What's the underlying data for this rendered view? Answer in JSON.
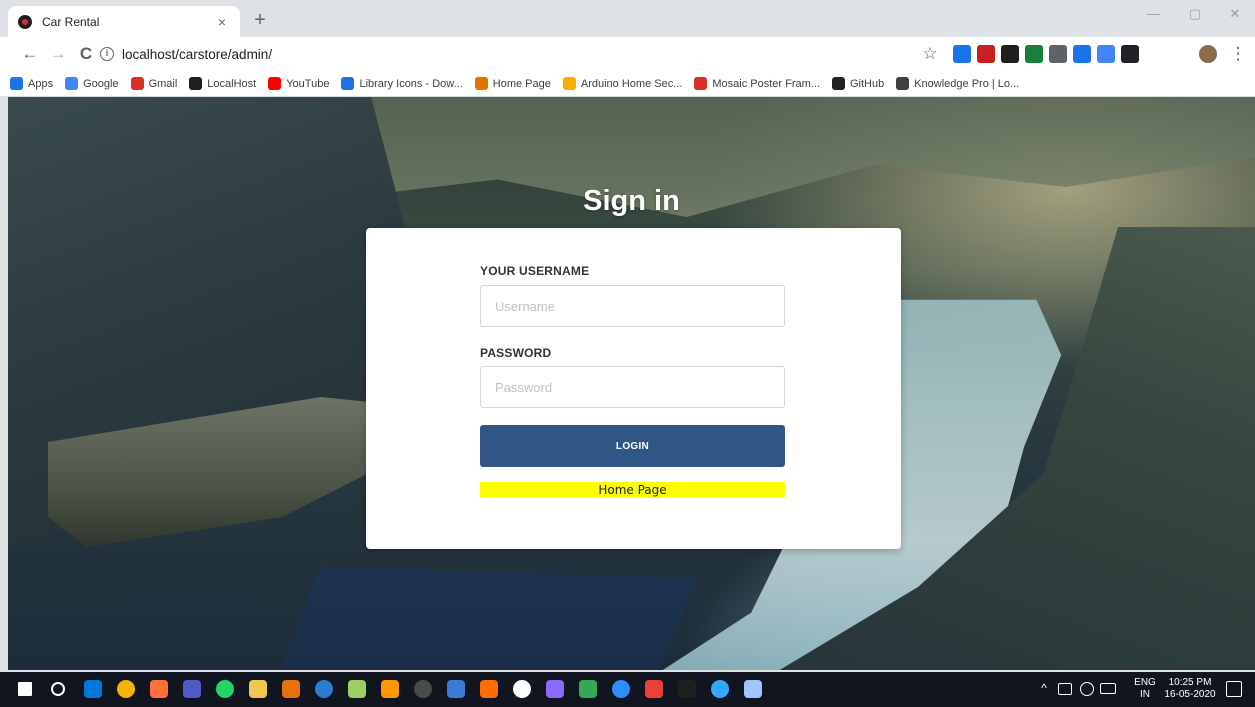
{
  "browser": {
    "tab_title": "Car Rental",
    "tab_close": "×",
    "new_tab": "+",
    "url": "localhost/carstore/admin/",
    "back": "←",
    "forward": "→",
    "reload": "C",
    "star": "☆",
    "minimize": "—",
    "maximize": "▢",
    "close": "✕",
    "menu": "⋮",
    "extension_colors": [
      "#1a73e8",
      "#c5221f",
      "#1f1f1f",
      "#188038",
      "#5f6368",
      "#1a73e8",
      "#4285f4",
      "#202124"
    ]
  },
  "bookmarks": [
    {
      "label": "Apps",
      "icon": "apps-icon",
      "color": "#1a73e8"
    },
    {
      "label": "Google",
      "icon": "google-icon",
      "color": "#4285f4"
    },
    {
      "label": "Gmail",
      "icon": "gmail-icon",
      "color": "#d93025"
    },
    {
      "label": "LocalHost",
      "icon": "localhost-icon",
      "color": "#1f1f1f"
    },
    {
      "label": "YouTube",
      "icon": "youtube-icon",
      "color": "#ff0000"
    },
    {
      "label": "Library Icons - Dow...",
      "icon": "library-icon",
      "color": "#1a73e8"
    },
    {
      "label": "Home Page",
      "icon": "home-icon",
      "color": "#e37400"
    },
    {
      "label": "Arduino Home Sec...",
      "icon": "arduino-icon",
      "color": "#f9ab00"
    },
    {
      "label": "Mosaic Poster Fram...",
      "icon": "mosaic-icon",
      "color": "#d93025"
    },
    {
      "label": "GitHub",
      "icon": "github-icon",
      "color": "#202124"
    },
    {
      "label": "Knowledge Pro | Lo...",
      "icon": "knowledge-icon",
      "color": "#3c4043"
    }
  ],
  "page": {
    "title": "Sign in",
    "username_label": "YOUR USERNAME",
    "username_placeholder": "Username",
    "password_label": "PASSWORD",
    "password_placeholder": "Password",
    "login_label": "LOGIN",
    "home_link": "Home Page",
    "colors": {
      "button": "#2f5685",
      "link_bg": "#ffff00"
    }
  },
  "taskbar": {
    "lang": "ENG",
    "region": "IN",
    "time": "10:25 PM",
    "date": "16-05-2020",
    "tray_chevron": "^",
    "icon_colors": [
      "#ffffff",
      "#ffffff",
      "#0078d7",
      "#f4b400",
      "#ff7139",
      "#5059c9",
      "#25d366",
      "#f0c850",
      "#e8710a",
      "#2b7cd3",
      "#9fce63",
      "#ff9800",
      "#4a4a4a",
      "#3a7bd5",
      "#ff6d00",
      "#ffffff",
      "#8e67ff",
      "#34a853",
      "#2d8cff",
      "#ea4335",
      "#1f1f1f",
      "#31a8ff",
      "#a0c4ff"
    ]
  }
}
